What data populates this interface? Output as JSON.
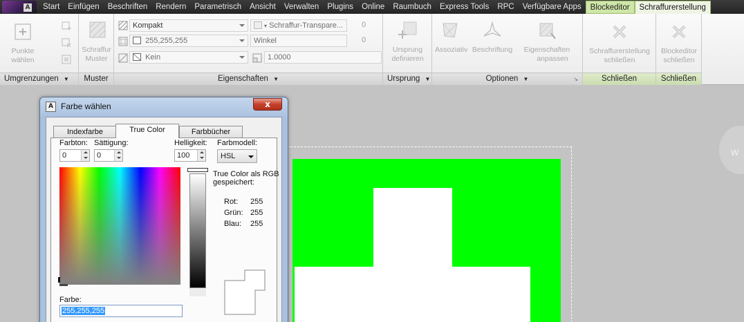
{
  "menu": {
    "tabs": [
      {
        "label": "Start"
      },
      {
        "label": "Einfügen"
      },
      {
        "label": "Beschriften"
      },
      {
        "label": "Rendern"
      },
      {
        "label": "Parametrisch"
      },
      {
        "label": "Ansicht"
      },
      {
        "label": "Verwalten"
      },
      {
        "label": "Plugins"
      },
      {
        "label": "Online"
      },
      {
        "label": "Raumbuch"
      },
      {
        "label": "Express Tools"
      },
      {
        "label": "RPC"
      },
      {
        "label": "Verfügbare Apps"
      },
      {
        "label": "Blockeditor"
      },
      {
        "label": "Schraffurerstellung"
      }
    ],
    "logo_letter": "A"
  },
  "ribbon": {
    "boundaries": {
      "pick_points": "Punkte wählen",
      "footer": "Umgrenzungen"
    },
    "pattern": {
      "button": [
        "Schraffur",
        "Muster"
      ],
      "footer": "Muster"
    },
    "properties": {
      "type": "Kompakt",
      "transparency": "Schraffur-Transpare...",
      "transparency_value": "0",
      "color": "255,255,255",
      "angle": "Winkel",
      "angle_value": "0",
      "background": "Kein",
      "scale": "1.0000",
      "footer": "Eigenschaften"
    },
    "origin": {
      "button": [
        "Ursprung",
        "definieren"
      ],
      "footer": "Ursprung"
    },
    "options": {
      "associative": "Assoziativ",
      "annotative": "Beschriftung",
      "match": [
        "Eigenschaften",
        "anpassen"
      ],
      "footer": "Optionen"
    },
    "close_hatch": {
      "button": [
        "Schraffurerstellung",
        "schließen"
      ],
      "footer": "Schließen"
    },
    "close_block": {
      "button": [
        "Blockeditor",
        "schließen"
      ],
      "footer": "Schließen"
    }
  },
  "dialog": {
    "title": "Farbe wählen",
    "app_icon_letter": "A",
    "close_symbol": "x",
    "tabs": [
      "Indexfarbe",
      "True Color",
      "Farbbücher"
    ],
    "active_tab": "True Color",
    "hue_label": "Farbton:",
    "hue_value": "0",
    "saturation_label": "Sättigung:",
    "saturation_value": "0",
    "luminance_label": "Helligkeit:",
    "luminance_value": "100",
    "model_label": "Farbmodell:",
    "model_value": "HSL",
    "rgb_note": [
      "True Color als RGB",
      "gespeichert:"
    ],
    "red_label": "Rot:",
    "red_value": "255",
    "green_label": "Grün:",
    "green_value": "255",
    "blue_label": "Blau:",
    "blue_value": "255",
    "color_label": "Farbe:",
    "color_value": "255,255,255"
  },
  "canvas": {
    "fill_color": "#00ff00",
    "viewcube_letter": "W"
  }
}
